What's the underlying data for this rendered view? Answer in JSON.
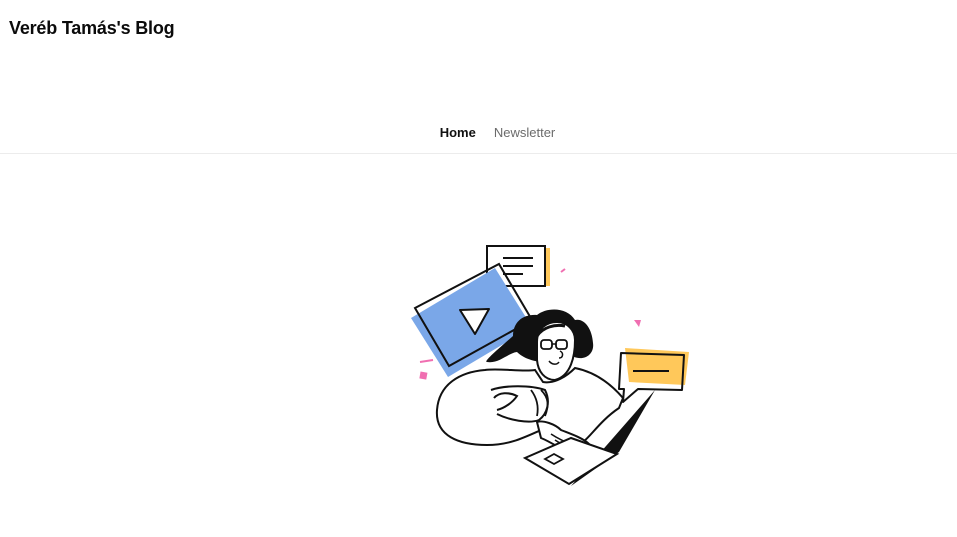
{
  "site": {
    "title": "Veréb Tamás's Blog"
  },
  "nav": {
    "items": [
      {
        "label": "Home",
        "active": true
      },
      {
        "label": "Newsletter",
        "active": false
      }
    ]
  },
  "illustration": {
    "icon": "person-with-laptop-illustration",
    "colors": {
      "blue": "#7aa7e8",
      "yellow": "#ffc85a",
      "pink": "#f06fb1",
      "ink": "#111111"
    }
  }
}
